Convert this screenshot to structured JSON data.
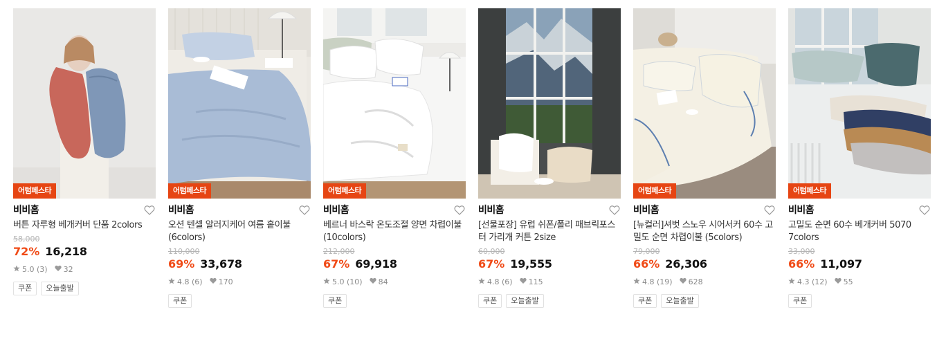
{
  "products": [
    {
      "badge": "어텀페스타",
      "brand": "비비홈",
      "title": "버튼 자루형 베개커버 단품 2colors",
      "original_price": "58,000",
      "discount": "72%",
      "price": "16,218",
      "rating": "5.0 (3)",
      "likes": "32",
      "tags": [
        "쿠폰",
        "오늘출발"
      ],
      "image": "woman-holding-pillows"
    },
    {
      "badge": "어텀페스타",
      "brand": "비비홈",
      "title": "오션 텐셀 알러지케어 여름 홑이불 (6colors)",
      "original_price": "110,000",
      "discount": "69%",
      "price": "33,678",
      "rating": "4.8 (6)",
      "likes": "170",
      "tags": [
        "쿠폰"
      ],
      "image": "blue-blanket-bed"
    },
    {
      "badge": "어텀페스타",
      "brand": "비비홈",
      "title": "베르너 바스락 온도조절 양면 차렵이불 (10colors)",
      "original_price": "212,000",
      "discount": "67%",
      "price": "69,918",
      "rating": "5.0 (10)",
      "likes": "84",
      "tags": [
        "쿠폰"
      ],
      "image": "white-comforter-bed"
    },
    {
      "badge": "",
      "brand": "비비홈",
      "title": "[선물포장] 유럽 쉬폰/폴리 패브릭포스터 가리개 커튼 2size",
      "original_price": "60,000",
      "discount": "67%",
      "price": "19,555",
      "rating": "4.8 (6)",
      "likes": "115",
      "tags": [
        "쿠폰",
        "오늘출발"
      ],
      "image": "mountain-window-poster"
    },
    {
      "badge": "어텀페스타",
      "brand": "비비홈",
      "title": "[뉴컬러]셔벗 스노우 시어서커 60수 고밀도 순면 차렵이불 (5colors)",
      "original_price": "79,000",
      "discount": "66%",
      "price": "26,306",
      "rating": "4.8 (19)",
      "likes": "628",
      "tags": [
        "쿠폰",
        "오늘출발"
      ],
      "image": "cream-seersucker-bed"
    },
    {
      "badge": "어텀페스타",
      "brand": "비비홈",
      "title": "고밀도 순면 60수 베개커버 5070 7colors",
      "original_price": "33,000",
      "discount": "66%",
      "price": "11,097",
      "rating": "4.3 (12)",
      "likes": "55",
      "tags": [
        "쿠폰"
      ],
      "image": "stacked-pillows"
    }
  ],
  "icons": {
    "like": "heart-outline-icon",
    "star": "star-icon",
    "heart": "heart-icon"
  },
  "colors": {
    "accent": "#f04a16",
    "badge": "#e64513"
  }
}
